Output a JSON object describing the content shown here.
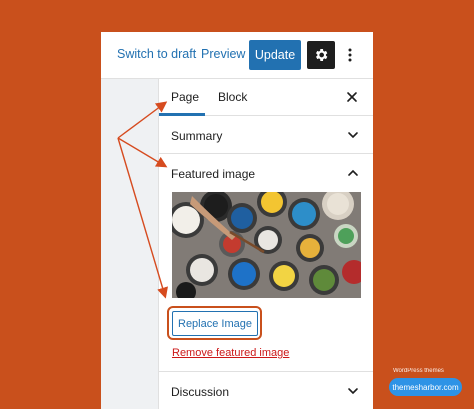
{
  "toolbar": {
    "switch_to_draft": "Switch to draft",
    "preview": "Preview",
    "update": "Update",
    "settings_icon": "gear-icon",
    "more_icon": "vertical-ellipsis-icon"
  },
  "sidebar": {
    "tabs": [
      {
        "label": "Page",
        "active": true
      },
      {
        "label": "Block",
        "active": false
      }
    ],
    "close_icon": "close-icon",
    "sections": {
      "summary": {
        "title": "Summary",
        "expanded": false
      },
      "featured_image": {
        "title": "Featured image",
        "expanded": true,
        "replace_label": "Replace Image",
        "remove_label": "Remove featured image"
      },
      "discussion": {
        "title": "Discussion",
        "expanded": false
      }
    }
  },
  "branding": {
    "tagline": "WordPress themes",
    "site": "themesharbor.com"
  },
  "colors": {
    "background": "#c9501c",
    "accent": "#2271b1",
    "danger": "#cc1818",
    "annotation": "#d64b1f",
    "badge": "#2e93e6"
  }
}
